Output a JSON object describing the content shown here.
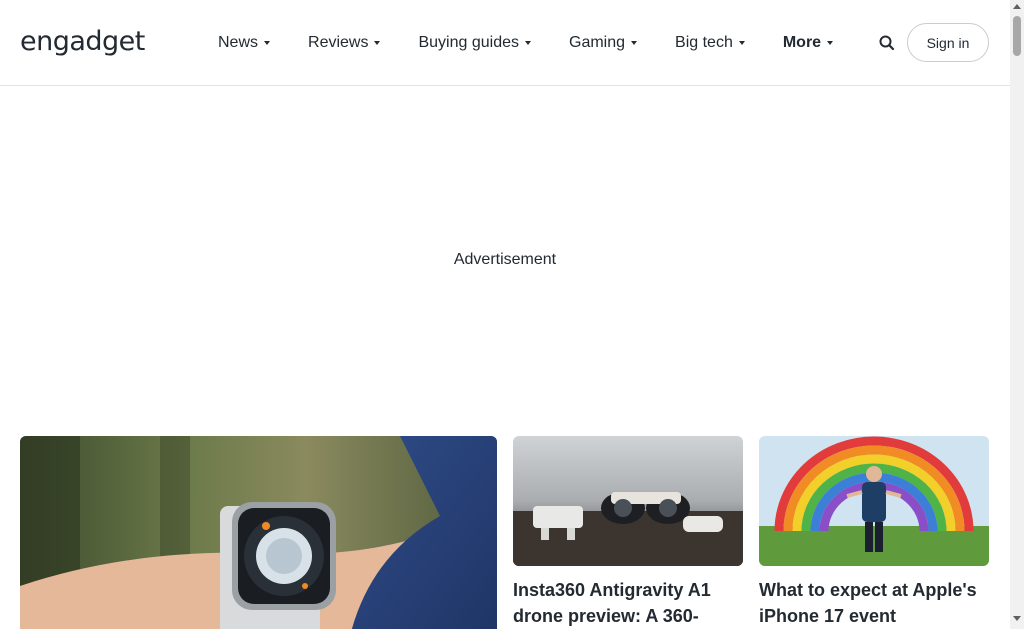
{
  "header": {
    "logo_text": "engadget",
    "nav": [
      {
        "label": "News"
      },
      {
        "label": "Reviews"
      },
      {
        "label": "Buying guides"
      },
      {
        "label": "Gaming"
      },
      {
        "label": "Big tech"
      },
      {
        "label": "More"
      }
    ],
    "search_icon": "search-icon",
    "sign_in_label": "Sign in"
  },
  "ad": {
    "label": "Advertisement"
  },
  "cards": [
    {
      "title": "Insta360 Antigravity A1 drone preview: A 360-"
    },
    {
      "title": "What to expect at Apple's iPhone 17 event"
    }
  ],
  "colors": {
    "text": "#232a31",
    "border": "#e0e4e9",
    "button_border": "#c7cdd2"
  }
}
